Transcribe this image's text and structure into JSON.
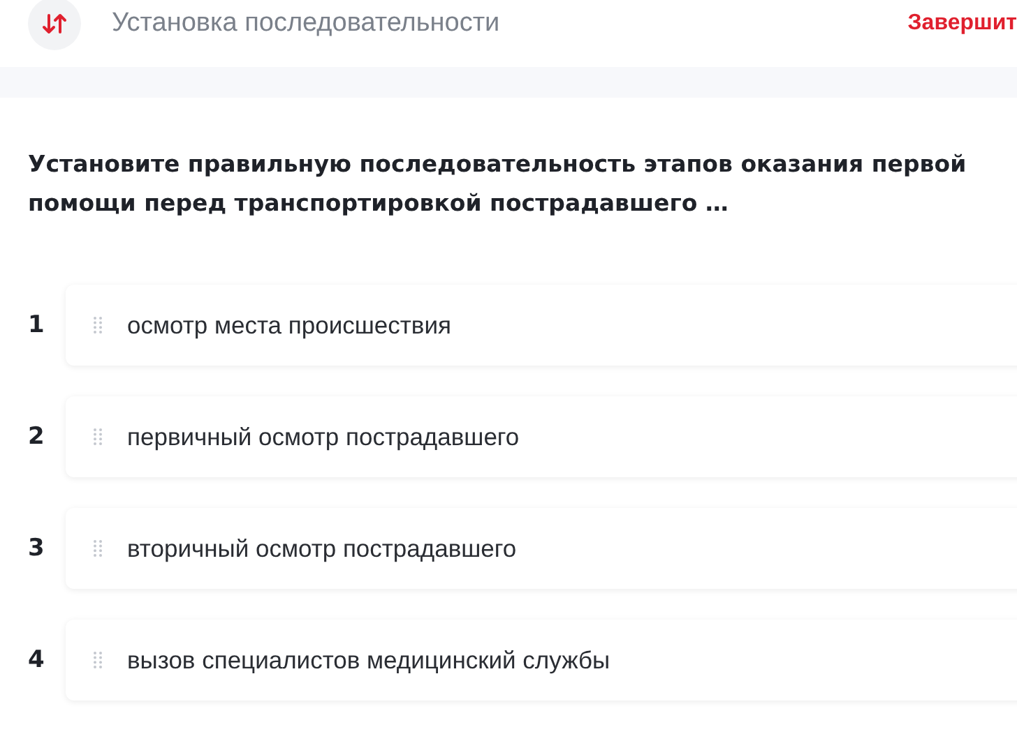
{
  "header": {
    "title": "Установка последовательности",
    "finish_button": "Завершит"
  },
  "question": "Установите правильную последовательность этапов оказания первой помощи перед транспортировкой пострадавшего …",
  "items": [
    {
      "number": "1",
      "text": "осмотр места происшествия"
    },
    {
      "number": "2",
      "text": "первичный осмотр пострадавшего"
    },
    {
      "number": "3",
      "text": "вторичный осмотр пострадавшего"
    },
    {
      "number": "4",
      "text": "вызов специалистов медицинский службы"
    }
  ]
}
